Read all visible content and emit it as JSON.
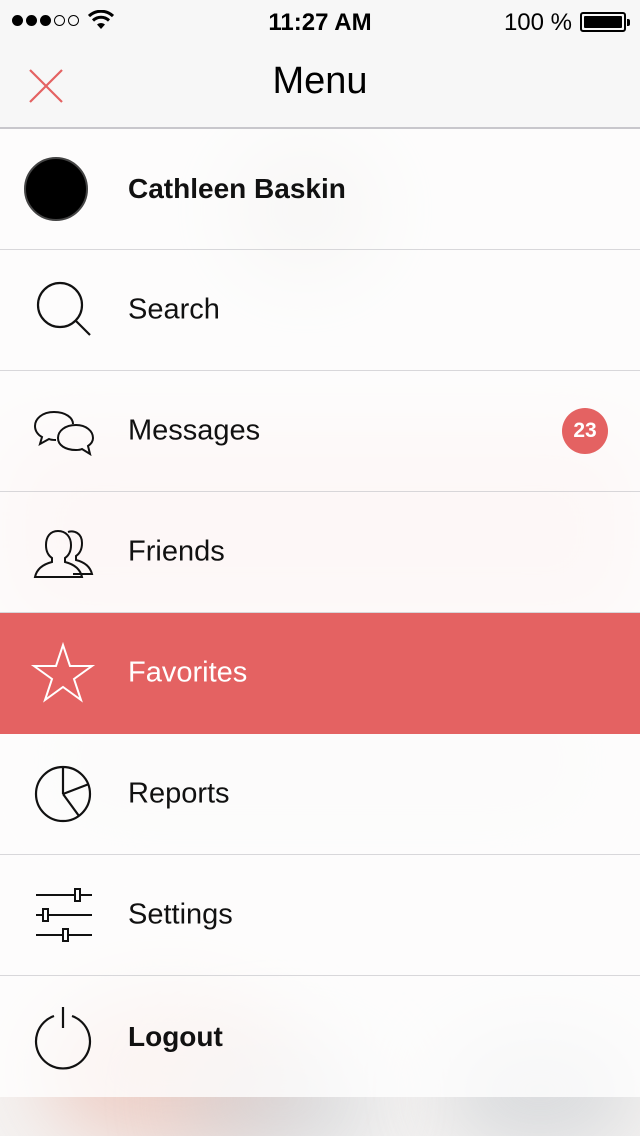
{
  "status_bar": {
    "time": "11:27 AM",
    "battery_percent": "100 %",
    "signal_bars_filled": 3,
    "signal_bars_total": 5
  },
  "nav_bar": {
    "title": "Menu",
    "close_icon": "close-icon"
  },
  "profile": {
    "name": "Cathleen Baskin"
  },
  "menu": {
    "items": [
      {
        "label": "Search",
        "icon": "search-icon"
      },
      {
        "label": "Messages",
        "icon": "chat-bubbles-icon",
        "badge": "23"
      },
      {
        "label": "Friends",
        "icon": "people-icon"
      },
      {
        "label": "Favorites",
        "icon": "star-icon",
        "active": true
      },
      {
        "label": "Reports",
        "icon": "pie-chart-icon"
      },
      {
        "label": "Settings",
        "icon": "sliders-icon"
      },
      {
        "label": "Logout",
        "icon": "power-icon"
      }
    ]
  },
  "colors": {
    "accent": "#e46262",
    "nav_background": "#f7f7f7",
    "separator": "#c8c7cc"
  }
}
